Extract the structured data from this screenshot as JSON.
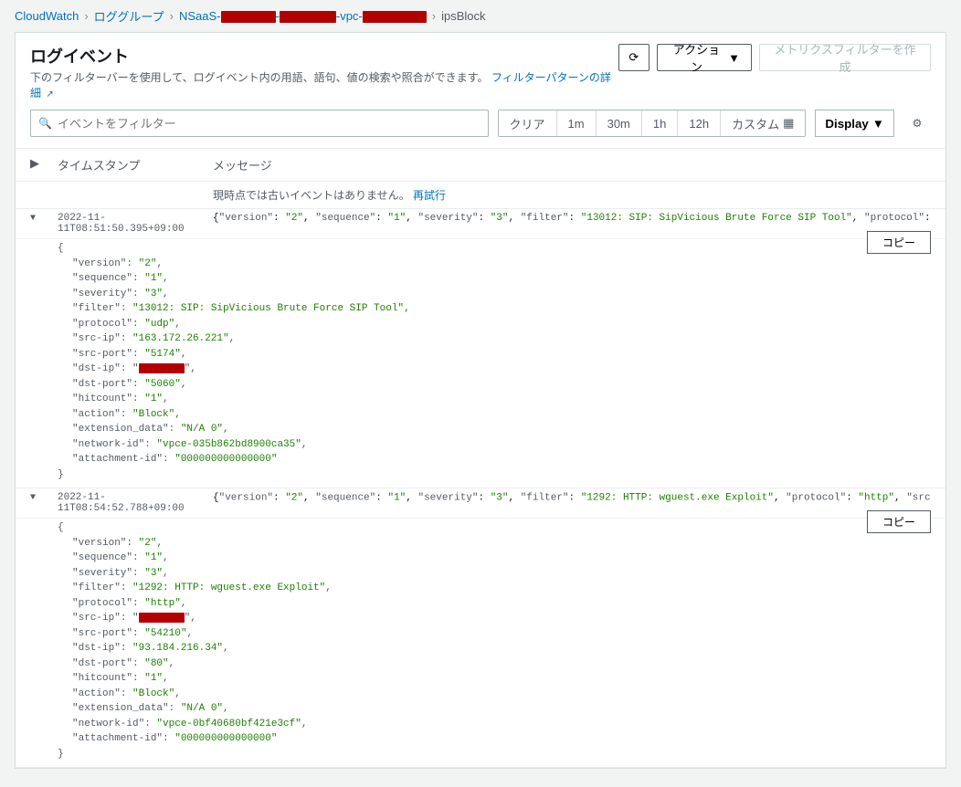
{
  "breadcrumb": {
    "root": "CloudWatch",
    "group": "ロググループ",
    "stream_prefix": "NSaaS-",
    "stream_mid": "-",
    "stream_vpc": "-vpc-",
    "current": "ipsBlock"
  },
  "header": {
    "title": "ログイベント",
    "subtitle_text": "下のフィルターバーを使用して、ログイベント内の用語、語句、値の検索や照合ができます。",
    "subtitle_link": "フィルターパターンの詳細",
    "action_label": "アクション",
    "metrics_label": "メトリクスフィルターを作成"
  },
  "filter": {
    "placeholder": "イベントをフィルター",
    "clear": "クリア",
    "r1m": "1m",
    "r30m": "30m",
    "r1h": "1h",
    "r12h": "12h",
    "custom": "カスタム",
    "display": "Display"
  },
  "table": {
    "col_ts": "タイムスタンプ",
    "col_msg": "メッセージ",
    "no_older": "現時点では古いイベントはありません。",
    "retry": "再試行",
    "copy": "コピー"
  },
  "events": [
    {
      "timestamp": "2022-11-11T08:51:50.395+09:00",
      "fields": {
        "version": "2",
        "sequence": "1",
        "severity": "3",
        "filter": "13012: SIP: SipVicious Brute Force SIP Tool",
        "protocol": "udp",
        "src-ip": "163.172.26.221",
        "src-port": "5174",
        "dst-ip": "_REDACT_",
        "dst-port": "5060",
        "hitcount": "1",
        "action": "Block",
        "extension_data": "N/A   0",
        "network-id": "vpce-035b862bd8900ca35",
        "attachment-id": "000000000000000"
      },
      "summary_redact_after": "src-ip"
    },
    {
      "timestamp": "2022-11-11T08:54:52.788+09:00",
      "fields": {
        "version": "2",
        "sequence": "1",
        "severity": "3",
        "filter": "1292: HTTP: wguest.exe Exploit",
        "protocol": "http",
        "src-ip": "_REDACT_",
        "src-port": "54210",
        "dst-ip": "93.184.216.34",
        "dst-port": "80",
        "hitcount": "1",
        "action": "Block",
        "extension_data": "N/A   0",
        "network-id": "vpce-0bf40680bf421e3cf",
        "attachment-id": "000000000000000"
      },
      "summary_redact_after": "src-ip",
      "summary_tail": "93.184.216.34"
    }
  ]
}
